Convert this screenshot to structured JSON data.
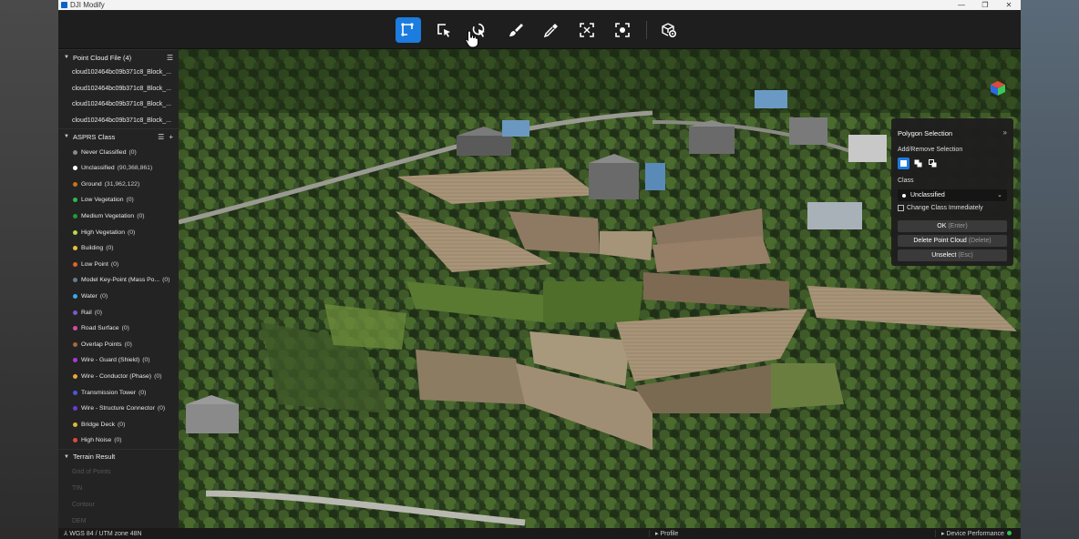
{
  "window": {
    "title": "DJI Modify",
    "controls": [
      "—",
      "❐",
      "✕"
    ]
  },
  "toolbar": {
    "tools": [
      {
        "name": "polygon-select-tool",
        "active": true
      },
      {
        "name": "box-select-tool",
        "active": false
      },
      {
        "name": "lasso-select-tool",
        "active": false
      },
      {
        "name": "brush-select-tool",
        "active": false
      },
      {
        "name": "eyedropper-tool",
        "active": false
      },
      {
        "name": "focus-select-tool",
        "active": false
      },
      {
        "name": "target-select-tool",
        "active": false
      },
      {
        "name": "settings-tool",
        "active": false
      }
    ]
  },
  "sidebar": {
    "point_cloud": {
      "title": "Point Cloud File",
      "count": "(4)",
      "files": [
        "cloud102464bc09b371c8_Block_...",
        "cloud102464bc09b371c8_Block_...",
        "cloud102464bc09b371c8_Block_...",
        "cloud102464bc09b371c8_Block_..."
      ]
    },
    "asprs": {
      "title": "ASPRS Class",
      "items": [
        {
          "label": "Never Classified",
          "count": "(0)",
          "color": "#8a8a8a"
        },
        {
          "label": "Unclassified",
          "count": "(90,368,861)",
          "color": "#ffffff"
        },
        {
          "label": "Ground",
          "count": "(31,962,122)",
          "color": "#c8731c"
        },
        {
          "label": "Low Vegetation",
          "count": "(0)",
          "color": "#2fb84c"
        },
        {
          "label": "Medium Vegetation",
          "count": "(0)",
          "color": "#1f9a3a"
        },
        {
          "label": "High Vegetation",
          "count": "(0)",
          "color": "#b7d84a"
        },
        {
          "label": "Building",
          "count": "(0)",
          "color": "#e8c13a"
        },
        {
          "label": "Low Point",
          "count": "(0)",
          "color": "#e0642a"
        },
        {
          "label": "Model Key-Point (Mass Po...",
          "count": "(0)",
          "color": "#6a7a8a"
        },
        {
          "label": "Water",
          "count": "(0)",
          "color": "#3aa8e8"
        },
        {
          "label": "Rail",
          "count": "(0)",
          "color": "#7a5ac8"
        },
        {
          "label": "Road Surface",
          "count": "(0)",
          "color": "#d84aa0"
        },
        {
          "label": "Overlap Points",
          "count": "(0)",
          "color": "#a8683a"
        },
        {
          "label": "Wire - Guard (Shield)",
          "count": "(0)",
          "color": "#a83ad8"
        },
        {
          "label": "Wire - Conductor (Phase)",
          "count": "(0)",
          "color": "#e8a83a"
        },
        {
          "label": "Transmission Tower",
          "count": "(0)",
          "color": "#4a5ad8"
        },
        {
          "label": "Wire - Structure Connector",
          "count": "(0)",
          "color": "#6a3ad8"
        },
        {
          "label": "Bridge Deck",
          "count": "(0)",
          "color": "#d8b83a"
        },
        {
          "label": "High Noise",
          "count": "(0)",
          "color": "#e04a3a"
        }
      ]
    },
    "terrain": {
      "title": "Terrain Result",
      "items": [
        "Grid of Points",
        "TIN",
        "Contour",
        "DEM"
      ]
    }
  },
  "panel": {
    "title": "Polygon Selection",
    "add_remove_label": "Add/Remove Selection",
    "class_label": "Class",
    "class_value": "Unclassified",
    "change_immediately": "Change Class Immediately",
    "ok": {
      "label": "OK",
      "key": "(Enter)"
    },
    "delete": {
      "label": "Delete Point Cloud",
      "key": "(Delete)"
    },
    "unselect": {
      "label": "Unselect",
      "key": "(Esc)"
    }
  },
  "status": {
    "crs": "WGS 84 / UTM zone 48N",
    "profile": "Profile",
    "performance": "Device Performance"
  }
}
